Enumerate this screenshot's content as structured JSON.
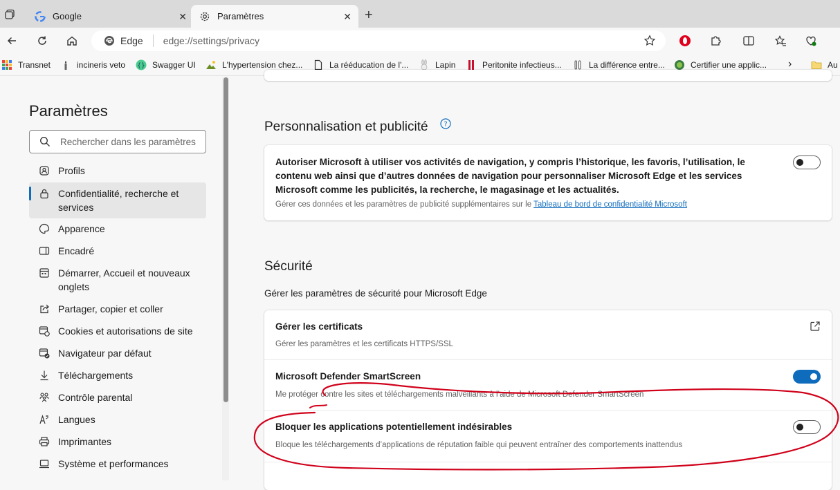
{
  "tabs": [
    {
      "label": "Google",
      "active": false
    },
    {
      "label": "Paramètres",
      "active": true
    }
  ],
  "toolbar": {
    "address_prefix": "Edge",
    "address_scheme": "edge://",
    "address_rest": "settings/privacy"
  },
  "bookmarks": [
    {
      "label": "Transnet"
    },
    {
      "label": "incineris veto"
    },
    {
      "label": "Swagger UI"
    },
    {
      "label": "L'hypertension chez..."
    },
    {
      "label": "La rééducation de l'..."
    },
    {
      "label": "Lapin"
    },
    {
      "label": "Peritonite infectieus..."
    },
    {
      "label": "La différence entre..."
    },
    {
      "label": "Certifier une applic..."
    },
    {
      "label": "Au"
    }
  ],
  "sidebar": {
    "title": "Paramètres",
    "search_placeholder": "Rechercher dans les paramètres",
    "items": [
      {
        "label": "Profils",
        "icon": "profile-icon"
      },
      {
        "label": "Confidentialité, recherche et services",
        "icon": "lock-icon",
        "active": true
      },
      {
        "label": "Apparence",
        "icon": "palette-icon"
      },
      {
        "label": "Encadré",
        "icon": "sidebar-panel-icon"
      },
      {
        "label": "Démarrer, Accueil et nouveaux onglets",
        "icon": "home-grid-icon"
      },
      {
        "label": "Partager, copier et coller",
        "icon": "share-icon"
      },
      {
        "label": "Cookies et autorisations de site",
        "icon": "cookie-icon"
      },
      {
        "label": "Navigateur par défaut",
        "icon": "browser-check-icon"
      },
      {
        "label": "Téléchargements",
        "icon": "download-icon"
      },
      {
        "label": "Contrôle parental",
        "icon": "family-icon"
      },
      {
        "label": "Langues",
        "icon": "language-icon"
      },
      {
        "label": "Imprimantes",
        "icon": "printer-icon"
      },
      {
        "label": "Système et performances",
        "icon": "laptop-icon"
      }
    ]
  },
  "main": {
    "personalization": {
      "title": "Personnalisation et publicité",
      "setting_title": "Autoriser Microsoft à utiliser vos activités de navigation, y compris l’historique, les favoris, l’utilisation, le contenu web ainsi que d’autres données de navigation pour personnaliser Microsoft Edge et les services Microsoft comme les publicités, la recherche, le magasinage et les actualités.",
      "desc_prefix": "Gérer ces données et les paramètres de publicité supplémentaires sur le",
      "desc_link": "Tableau de bord de confidentialité Microsoft",
      "enabled": false
    },
    "security": {
      "title": "Sécurité",
      "subtitle": "Gérer les paramètres de sécurité pour Microsoft Edge",
      "items": [
        {
          "title": "Gérer les certificats",
          "desc": "Gérer les paramètres et les certificats HTTPS/SSL",
          "control": "external-link"
        },
        {
          "title": "Microsoft Defender SmartScreen",
          "desc": "Me protéger contre les sites et téléchargements malveillants à l’aide de Microsoft Defender SmartScreen",
          "control": "toggle",
          "enabled": true
        },
        {
          "title": "Bloquer les applications potentiellement indésirables",
          "desc": "Bloque les téléchargements d’applications de réputation faible qui peuvent entraîner des comportements inattendus",
          "control": "toggle",
          "enabled": false
        }
      ]
    }
  },
  "colors": {
    "accent": "#0f6cbd",
    "annotation": "#d0021b"
  }
}
